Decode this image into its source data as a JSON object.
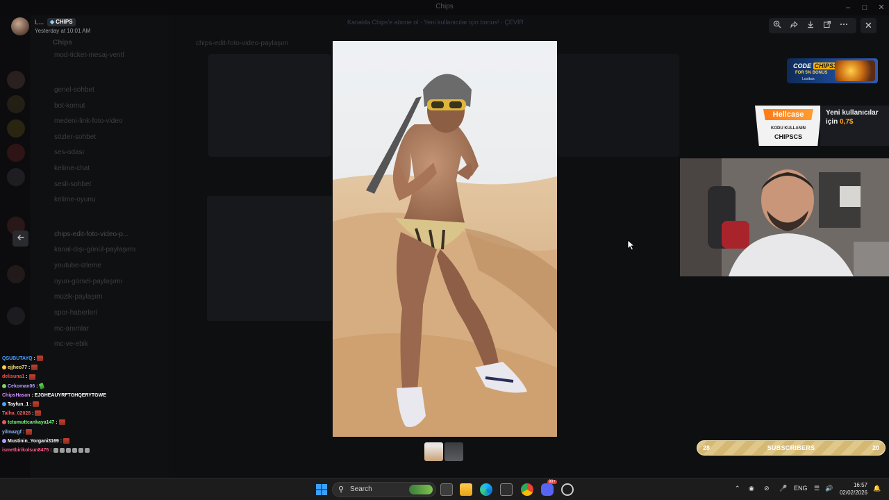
{
  "window": {
    "title": "Chips"
  },
  "viewer": {
    "username": "L...",
    "role_badge": "CHIPS",
    "timestamp": "Yesterday at 10:01 AM",
    "banner_text": "Kanalda Chips'e abone ol · Yeni kullanıcılar için bonus! · ÇEVİR",
    "toolbar": [
      "zoom-in-icon",
      "forward-icon",
      "download-icon",
      "open-external-icon",
      "more-icon"
    ],
    "close_icon": "close-icon"
  },
  "discord_bg": {
    "server_name": "Chips",
    "active_channel": "chips-edit-foto-video-paylaşım",
    "channels": [
      "mod-ticket-mesaj-ventl",
      "genel-sohbet",
      "bot-komut",
      "medeni-link-foto-video",
      "sözler-sohbet",
      "ses-odası",
      "kelime-chat",
      "sesli-sohbet",
      "kelime-oyunu",
      "chips-edit-foto-video-p...",
      "kanal-dışı-gönül-paylaşımı",
      "youtube-izleme",
      "oyun-görsel-paylaşımı",
      "müzik-paylaşım",
      "spor-haberleri",
      "mc-anımlar",
      "mc-ve-ebik"
    ]
  },
  "stream": {
    "code_ad": {
      "line1_prefix": "CODE",
      "code": "CHIPS31",
      "line2": "FOR 5% BONUS",
      "brand": "Lootbox"
    },
    "hellcase": {
      "brand": "Hellcase",
      "sub": "KODU KULLANIN",
      "code": "CHIPSCS",
      "line1": "Yeni kullanıcılar",
      "line2_prefix": "için",
      "amount": "0,7$"
    },
    "subscribers": {
      "left": "28",
      "label": "SUBSCRIBERS",
      "right": "20",
      "progress": 0.95
    }
  },
  "chat": [
    {
      "user": "QSUBUTAYQ",
      "color": "#4aa3ff",
      "msg": "",
      "emotes": 1
    },
    {
      "user": "ejjheo77",
      "color": "#ffe27a",
      "msg": "",
      "emotes": 1
    },
    {
      "user": "delisuna1",
      "color": "#ff4d4d",
      "msg": "",
      "emotes": 1
    },
    {
      "user": "Cekoman06",
      "color": "#b59cff",
      "msg": "",
      "emotes": 0,
      "green": true
    },
    {
      "user": "ChipsHasan",
      "color": "#d58cff",
      "msg": "EJGHEAUYRFTGHQERYTGWE",
      "emotes": 0
    },
    {
      "user": "Tayfun_1",
      "color": "#ffffff",
      "msg": "",
      "emotes": 1
    },
    {
      "user": "Talha_02028",
      "color": "#ff5c5c",
      "msg": "",
      "emotes": 1
    },
    {
      "user": "tctumuttcankaya147",
      "color": "#7cff7c",
      "msg": "",
      "emotes": 1
    },
    {
      "user": "yilmazgf",
      "color": "#8fb8ff",
      "msg": "",
      "emotes": 1
    },
    {
      "user": "Mustinin_Yorgani3169",
      "color": "#ffffff",
      "msg": "",
      "emotes": 1
    },
    {
      "user": "ismetbirikolsun8475",
      "color": "#ff5c8a",
      "msg": "",
      "emotes": 0,
      "grey": 6
    }
  ],
  "taskbar": {
    "search_placeholder": "Search",
    "language": "ENG",
    "time": "16:57",
    "date": "02/02/2026",
    "discord_badge": "99+"
  },
  "colors": {
    "accent_orange": "#ff7a18",
    "subbar_gold": "#d4b873",
    "discord_red": "#d9534f"
  }
}
